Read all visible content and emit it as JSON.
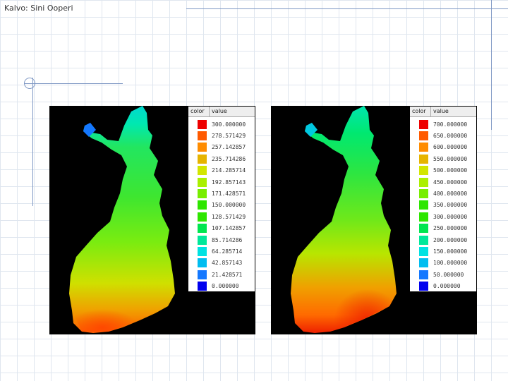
{
  "caption": "Kalvo: Sini Ooperi",
  "legend_header": {
    "color": "color",
    "value": "value"
  },
  "colors": [
    "#ee0000",
    "#ff5a00",
    "#ff8c00",
    "#e6b400",
    "#d2e600",
    "#aaf000",
    "#78ee00",
    "#2ee600",
    "#00e650",
    "#00e89a",
    "#00e2e2",
    "#00bdf0",
    "#1478ff",
    "#0000ee"
  ],
  "maps": [
    {
      "legend_values": [
        "300.000000",
        "278.571429",
        "257.142857",
        "235.714286",
        "214.285714",
        "192.857143",
        "171.428571",
        "150.000000",
        "128.571429",
        "107.142857",
        "85.714286",
        "64.285714",
        "42.857143",
        "21.428571",
        "0.000000"
      ]
    },
    {
      "legend_values": [
        "700.000000",
        "650.000000",
        "600.000000",
        "550.000000",
        "500.000000",
        "450.000000",
        "400.000000",
        "350.000000",
        "300.000000",
        "250.000000",
        "200.000000",
        "150.000000",
        "100.000000",
        "50.000000",
        "0.000000"
      ]
    }
  ]
}
